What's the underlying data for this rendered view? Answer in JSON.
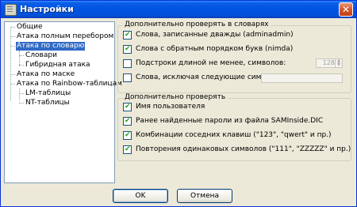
{
  "window": {
    "title": "Настройки",
    "close_glyph": "✕",
    "icon": "settings-window-icon"
  },
  "tree": {
    "items": [
      {
        "label": "Общие"
      },
      {
        "label": "Атака полным перебором"
      },
      {
        "label": "Атака по словарю",
        "selected": true
      },
      {
        "label": "Словари"
      },
      {
        "label": "Гибридная атака"
      },
      {
        "label": "Атака по маске"
      },
      {
        "label": "Атака по Rainbow-таблицам"
      },
      {
        "label": "LM-таблицы"
      },
      {
        "label": "NT-таблицы"
      }
    ]
  },
  "group1": {
    "title": "Дополнительно проверять в словарях",
    "options": [
      {
        "label": "Слова, записанные дважды (adminadmin)",
        "checked": true
      },
      {
        "label": "Слова с обратным порядком букв (nimda)",
        "checked": true
      },
      {
        "label": "Подстроки длиной не менее, символов:",
        "checked": false
      },
      {
        "label": "Слова, исключая следующие символы",
        "checked": false
      }
    ],
    "min_length_value": "128",
    "exclude_value": ""
  },
  "group2": {
    "title": "Дополнительно проверять",
    "options": [
      {
        "label": "Имя пользователя",
        "checked": true
      },
      {
        "label": "Ранее найденные пароли из файла SAMInside.DIC",
        "checked": true
      },
      {
        "label": "Комбинации соседних клавиш (\"123\", \"qwert\" и пр.)",
        "checked": true
      },
      {
        "label": "Повторения одинаковых символов (\"111\", \"ZZZZZ\" и пр.)",
        "checked": true
      }
    ]
  },
  "buttons": {
    "ok": "OK",
    "cancel": "Отмена"
  }
}
